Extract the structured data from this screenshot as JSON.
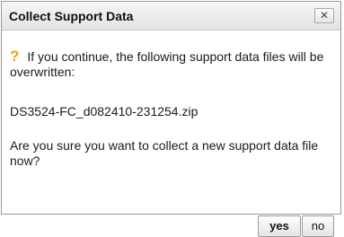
{
  "dialog": {
    "title": "Collect Support Data",
    "close_glyph": "✕",
    "icon": "question-mark-icon",
    "icon_glyph": "?",
    "message_intro": "If you continue, the following support data files will be overwritten:",
    "filename": "DS3524-FC_d082410-231254.zip",
    "message_question": "Are you sure you want to collect a new support data file now?",
    "yes_label": "yes",
    "no_label": "no"
  },
  "colors": {
    "icon": "#f2a10a"
  }
}
